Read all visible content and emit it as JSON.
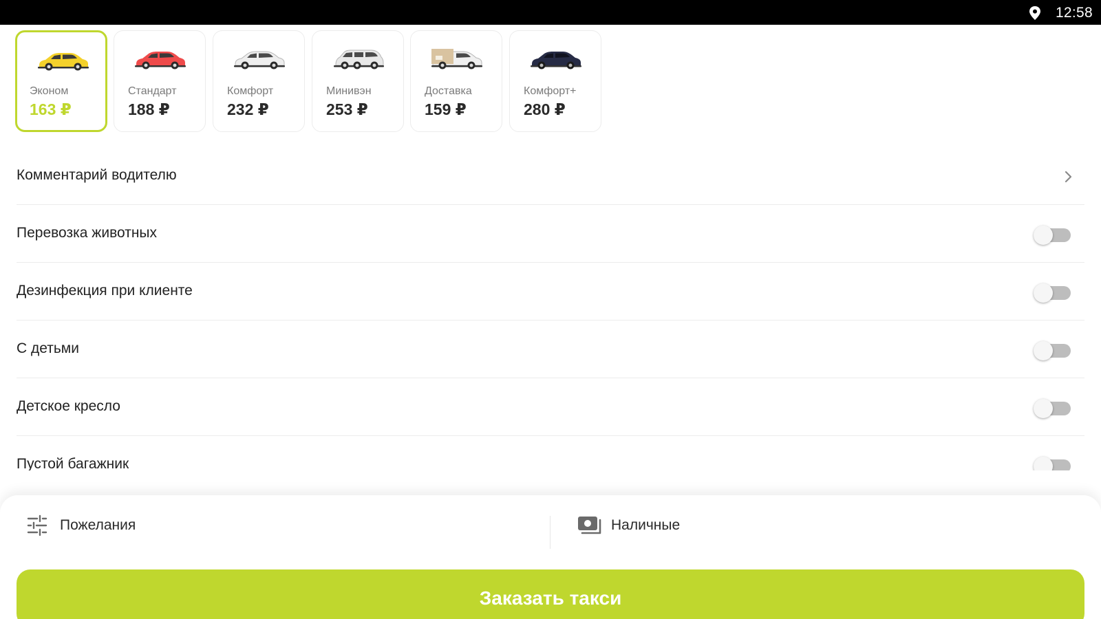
{
  "status_bar": {
    "time": "12:58",
    "location_icon": "location-pin-icon"
  },
  "tariffs": [
    {
      "name": "Эконом",
      "price": "163 ₽",
      "selected": true,
      "car_color": "#f4d12b",
      "icon": "car-yellow-icon"
    },
    {
      "name": "Стандарт",
      "price": "188 ₽",
      "selected": false,
      "car_color": "#ef4b4b",
      "icon": "car-red-icon"
    },
    {
      "name": "Комфорт",
      "price": "232 ₽",
      "selected": false,
      "car_color": "#eeeeee",
      "icon": "car-white-icon"
    },
    {
      "name": "Минивэн",
      "price": "253 ₽",
      "selected": false,
      "car_color": "#e8e8e8",
      "icon": "minivan-icon"
    },
    {
      "name": "Доставка",
      "price": "159 ₽",
      "selected": false,
      "car_color": "#f0f0f0",
      "icon": "delivery-car-icon"
    },
    {
      "name": "Комфорт+",
      "price": "280 ₽",
      "selected": false,
      "car_color": "#262b45",
      "icon": "car-dark-icon"
    }
  ],
  "options": {
    "comment_label": "Комментарий водителю",
    "toggles": [
      {
        "label": "Перевозка животных",
        "on": false
      },
      {
        "label": "Дезинфекция при клиенте",
        "on": false
      },
      {
        "label": "С детьми",
        "on": false
      },
      {
        "label": "Детское кресло",
        "on": false
      },
      {
        "label": "Пустой багажник",
        "on": false
      }
    ]
  },
  "bottom": {
    "wishes_label": "Пожелания",
    "wishes_icon": "sliders-icon",
    "payment_label": "Наличные",
    "payment_icon": "cash-icon",
    "order_button": "Заказать такси"
  },
  "colors": {
    "accent": "#bfd72e",
    "toggle_off_track": "#bdbdbd",
    "divider": "#ececec"
  }
}
